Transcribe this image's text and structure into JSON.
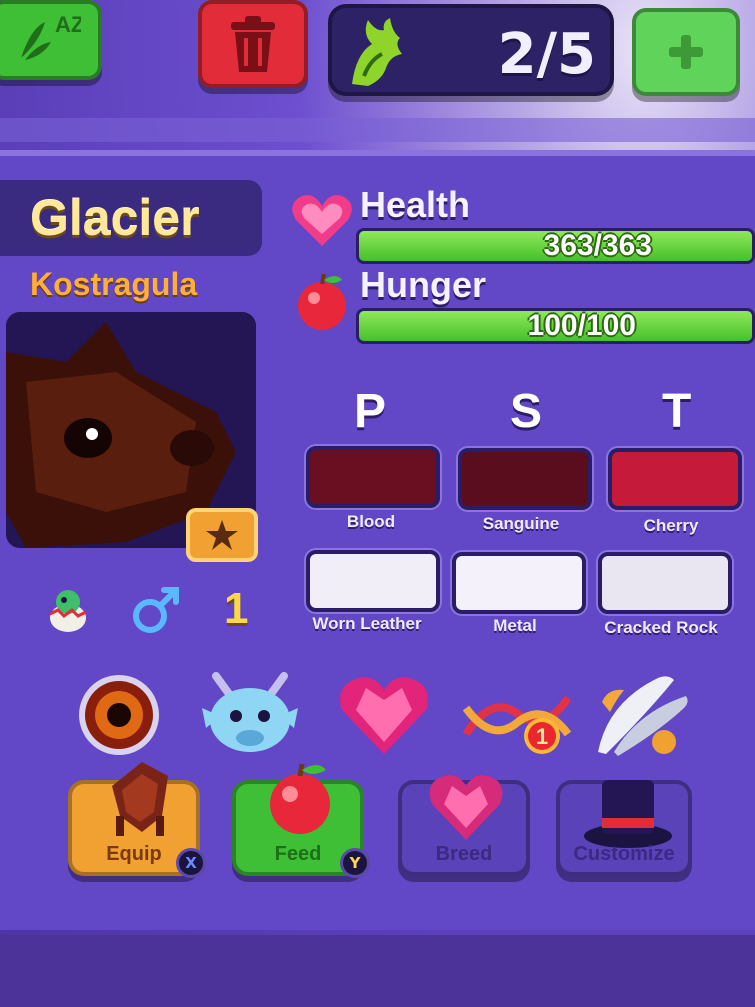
{
  "top_bar": {
    "sort_button_label": "AZ",
    "counter": "2/5",
    "colors": {
      "sort": "#3fbf36",
      "trash": "#e22c3a",
      "add": "#5fd35a"
    }
  },
  "pet": {
    "name": "Glacier",
    "species": "Kostragula",
    "level": "1",
    "gender_icon": "male-icon"
  },
  "stats": [
    {
      "label": "Health",
      "value": "363/363",
      "fill": 1.0,
      "icon": "heart-icon"
    },
    {
      "label": "Hunger",
      "value": "100/100",
      "fill": 1.0,
      "icon": "apple-icon"
    }
  ],
  "pst": {
    "headers": [
      "P",
      "S",
      "T"
    ],
    "color_swatches": [
      {
        "label": "Blood",
        "color": "#6a0f22"
      },
      {
        "label": "Sanguine",
        "color": "#5a0d1c"
      },
      {
        "label": "Cherry",
        "color": "#c61a3a"
      }
    ],
    "texture_swatches": [
      {
        "label": "Worn Leather",
        "color": "#f1eef7"
      },
      {
        "label": "Metal",
        "color": "#f4f1fb"
      },
      {
        "label": "Cracked Rock",
        "color": "#e9e6f2"
      }
    ]
  },
  "abilities": [
    {
      "icon": "eye-icon"
    },
    {
      "icon": "dragon-face-icon"
    },
    {
      "icon": "gem-heart-icon"
    },
    {
      "icon": "dna-icon",
      "badge": "1"
    },
    {
      "icon": "feathers-icon"
    }
  ],
  "actions": [
    {
      "label": "Equip",
      "key": "X",
      "color": "#f0a132"
    },
    {
      "label": "Feed",
      "key": "Y",
      "color": "#3fbf36"
    },
    {
      "label": "Breed",
      "color": "#5a42b8"
    },
    {
      "label": "Customize",
      "color": "#5a42b8"
    }
  ]
}
